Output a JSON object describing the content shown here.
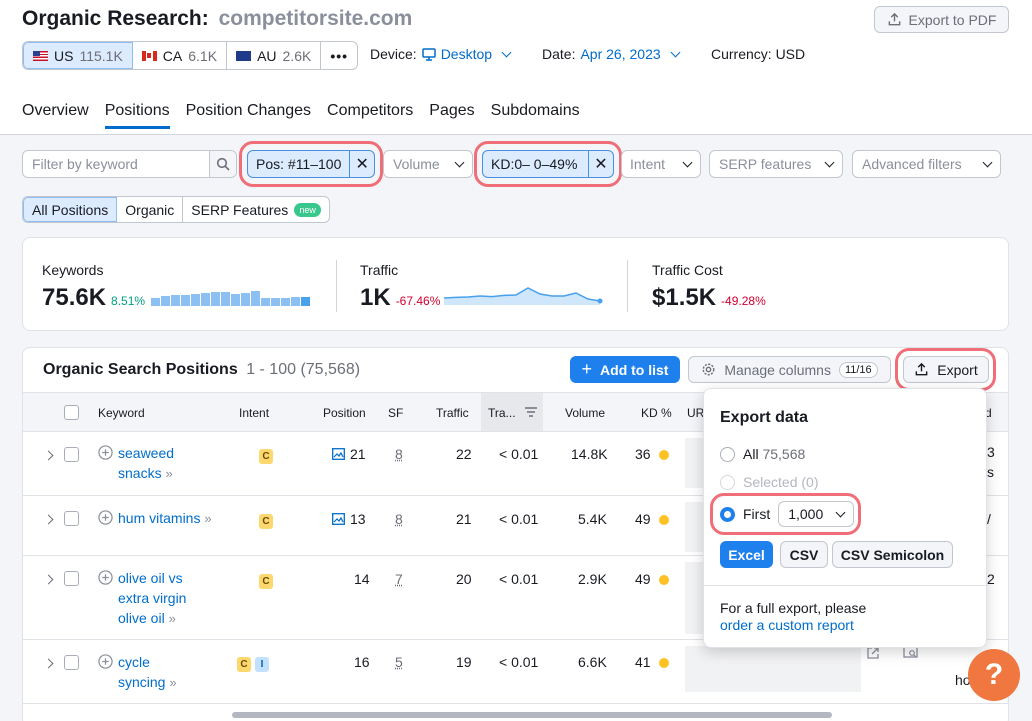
{
  "header": {
    "title": "Organic Research:",
    "domain": "competitorsite.com",
    "export_pdf_label": "Export to PDF"
  },
  "countries": [
    {
      "code": "US",
      "count": "115.1K",
      "flag": "us"
    },
    {
      "code": "CA",
      "count": "6.1K",
      "flag": "ca"
    },
    {
      "code": "AU",
      "count": "2.6K",
      "flag": "au"
    }
  ],
  "countries_more": "•••",
  "device": {
    "label": "Device:",
    "value": "Desktop"
  },
  "date": {
    "label": "Date:",
    "value": "Apr 26, 2023"
  },
  "currency": {
    "label": "Currency: USD"
  },
  "tabs": [
    "Overview",
    "Positions",
    "Position Changes",
    "Competitors",
    "Pages",
    "Subdomains"
  ],
  "filters": {
    "keyword_placeholder": "Filter by keyword",
    "pos_chip": "Pos: #11–100",
    "volume": "Volume",
    "kd_chip": "KD:0– 0–49%",
    "intent": "Intent",
    "serp_features": "SERP features",
    "advanced": "Advanced filters",
    "remove_symbol": "✕"
  },
  "segments": {
    "all": "All Positions",
    "organic": "Organic",
    "serp": "SERP Features",
    "new_badge": "new"
  },
  "summary": {
    "keywords": {
      "label": "Keywords",
      "value": "75.6K",
      "change": "8.51%"
    },
    "traffic": {
      "label": "Traffic",
      "value": "1K",
      "change": "-67.46%"
    },
    "traffic_cost": {
      "label": "Traffic Cost",
      "value": "$1.5K",
      "change": "-49.28%"
    },
    "keyword_bars": [
      0.45,
      0.55,
      0.6,
      0.6,
      0.65,
      0.7,
      0.75,
      0.8,
      0.65,
      0.7,
      0.85,
      0.45,
      0.45,
      0.45,
      0.5,
      0.5
    ],
    "traffic_line": [
      0.35,
      0.38,
      0.4,
      0.45,
      0.42,
      0.48,
      0.5,
      0.85,
      0.55,
      0.45,
      0.45,
      0.6,
      0.3,
      0.2
    ]
  },
  "table": {
    "title": "Organic Search Positions",
    "range": "1 - 100 (75,568)",
    "add_to_list": "Add to list",
    "manage_columns": "Manage columns",
    "columns_count": "11/16",
    "export_label": "Export",
    "columns": [
      "Keyword",
      "Intent",
      "Position",
      "SF",
      "Traffic",
      "Tra...",
      "Volume",
      "KD %",
      "UR"
    ],
    "rows": [
      {
        "kw1": "seaweed",
        "kw2": "snacks",
        "intent": [
          "C"
        ],
        "has_img": true,
        "position": "21",
        "sf": "8",
        "traffic": "22",
        "traffic_pct": "< 0.01",
        "volume": "14.8K",
        "kd": "36"
      },
      {
        "kw1": "hum vitamins",
        "kw2": "",
        "intent": [
          "C"
        ],
        "has_img": true,
        "position": "13",
        "sf": "8",
        "traffic": "21",
        "traffic_pct": "< 0.01",
        "volume": "5.4K",
        "kd": "49"
      },
      {
        "kw1": "olive oil vs",
        "kw2": "extra virgin",
        "kw3": "olive oil",
        "intent": [
          "C"
        ],
        "has_img": false,
        "position": "14",
        "sf": "7",
        "traffic": "20",
        "traffic_pct": "< 0.01",
        "volume": "2.9K",
        "kd": "49"
      },
      {
        "kw1": "cycle",
        "kw2": "syncing",
        "intent": [
          "C",
          "I"
        ],
        "has_img": false,
        "position": "16",
        "sf": "5",
        "traffic": "19",
        "traffic_pct": "< 0.01",
        "volume": "6.6K",
        "kd": "41"
      }
    ],
    "edge_fragments": [
      "3",
      "s",
      "/",
      "2",
      "ho"
    ]
  },
  "export_popup": {
    "title": "Export data",
    "all_label": "All",
    "all_count": "75,568",
    "selected_label": "Selected",
    "selected_count": "(0)",
    "first_label": "First",
    "first_value": "1,000",
    "formats": [
      "Excel",
      "CSV",
      "CSV Semicolon"
    ],
    "note_line1": "For a full export, please",
    "note_link": "order a custom report"
  },
  "help_label": "?",
  "colors": {
    "accent": "#006dca",
    "primary_button": "#1e80ed",
    "highlight_ring": "#ef6e78",
    "kd_dot": "#ffc224",
    "help": "#f07740"
  }
}
